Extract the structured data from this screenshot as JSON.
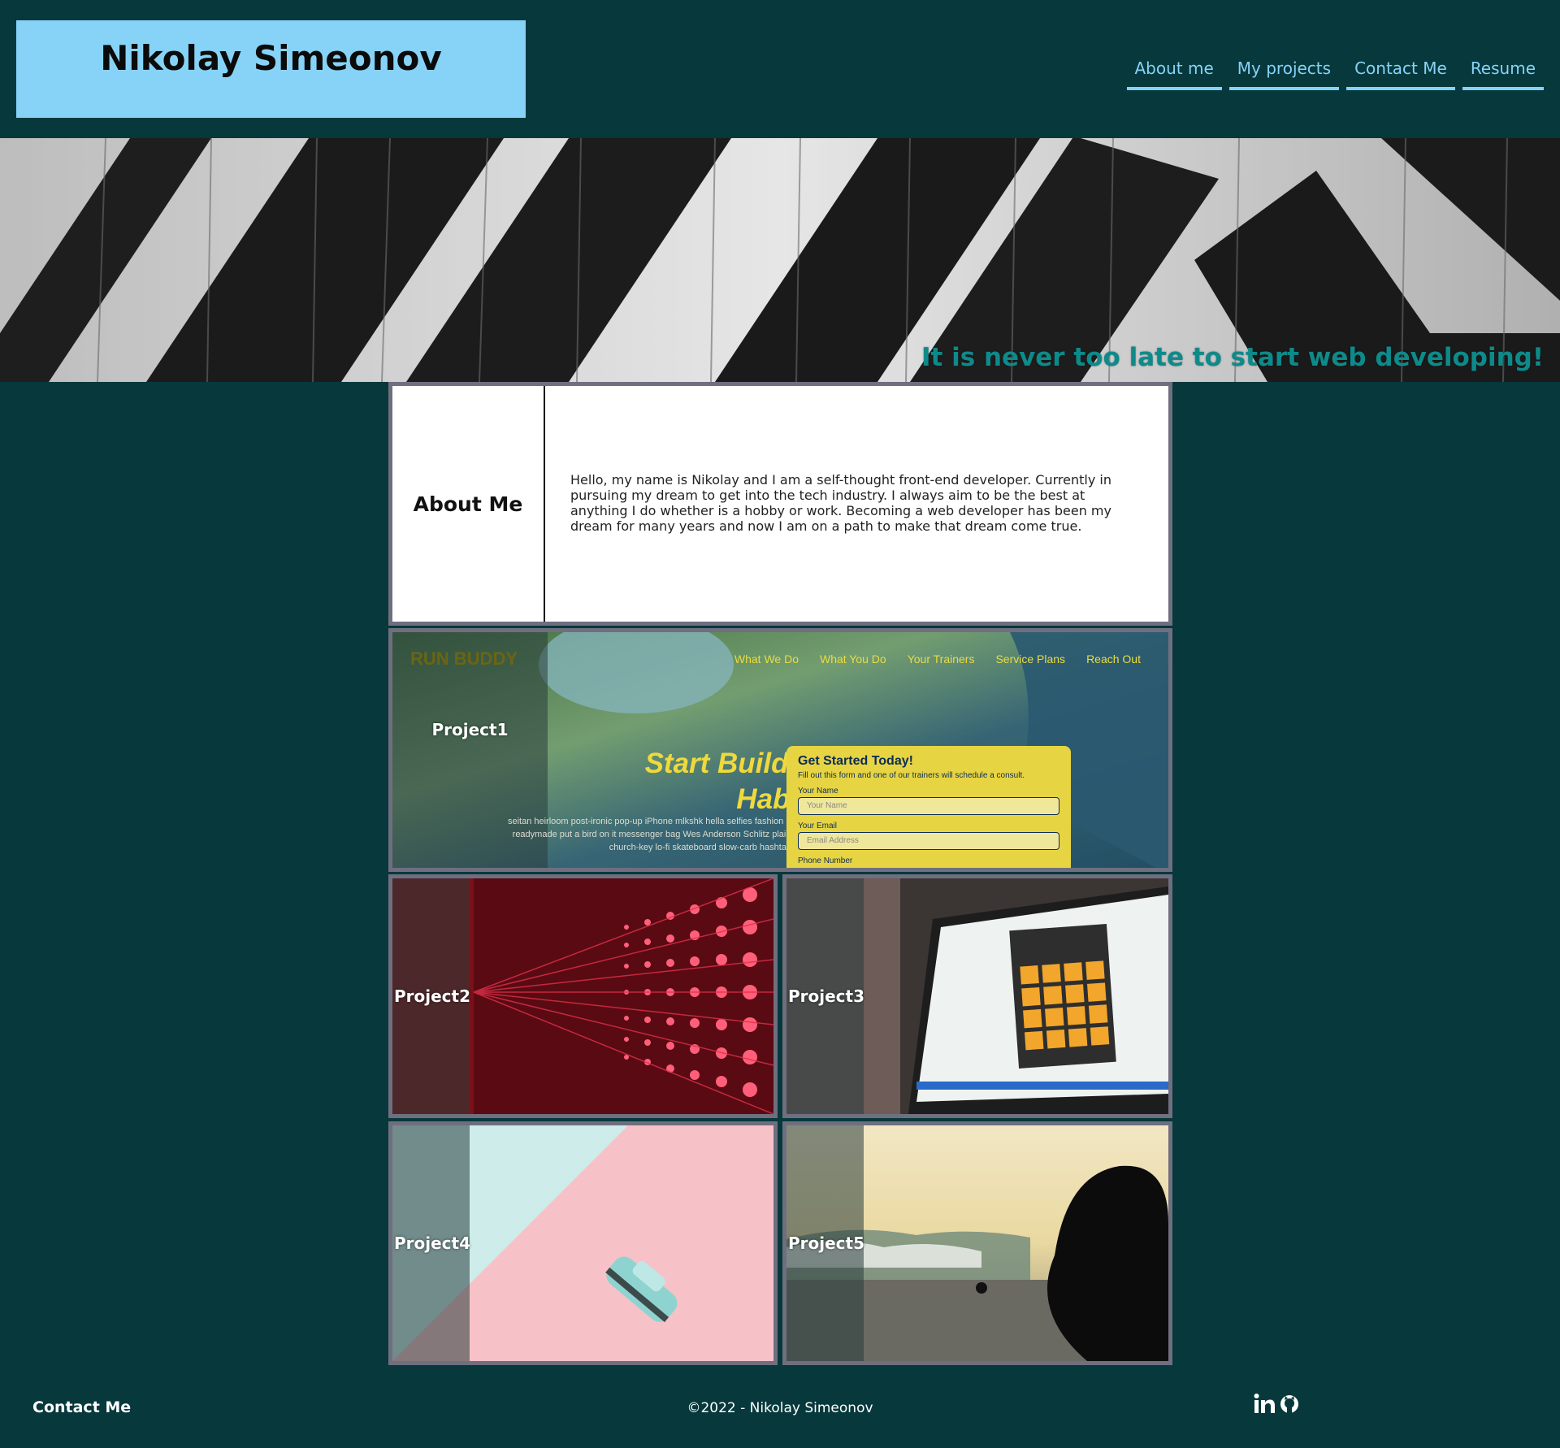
{
  "header": {
    "name": "Nikolay Simeonov",
    "nav": [
      "About me",
      "My projects",
      "Contact Me",
      "Resume"
    ]
  },
  "hero": {
    "tagline": "It is never too late to start web developing!"
  },
  "about": {
    "title": "About Me",
    "text": "Hello, my name is Nikolay and I am a self-thought front-end developer. Currently in pursuing my dream to get into the tech industry. I always aim to be the best at anything I do whether is a hobby or work. Becoming a web developer has been my dream for many years and now I am on a path to make that dream come true."
  },
  "projects": [
    {
      "label": "Project1",
      "preview": {
        "brand": "RUN BUDDY",
        "nav": [
          "What We Do",
          "What You Do",
          "Your Trainers",
          "Service Plans",
          "Reach Out"
        ],
        "headline_1": "Start Building",
        "headline_2": "Habits.",
        "body": "seitan heirloom post-ironic pop-up iPhone mlkshk hella selfies fashion axe occupy readymade put a bird on it messenger bag Wes Anderson Schlitz plaid Bushwick church-key lo-fi skateboard slow-carb hashtag trust fund",
        "form_title": "Get Started Today!",
        "form_sub": "Fill out this form and one of our trainers will schedule a consult.",
        "field_name_label": "Your Name",
        "field_name_placeholder": "Your Name",
        "field_email_label": "Your Email",
        "field_email_placeholder": "Email Address",
        "field_phone_label": "Phone Number"
      }
    },
    {
      "label": "Project2"
    },
    {
      "label": "Project3"
    },
    {
      "label": "Project4"
    },
    {
      "label": "Project5"
    }
  ],
  "footer": {
    "contact": "Contact Me",
    "copyright": "©2022 - Nikolay Simeonov",
    "icons": [
      "linkedin-icon",
      "github-icon"
    ]
  },
  "colors": {
    "background": "#06383c",
    "name_box": "#87d3f7",
    "nav": "#87d3f7",
    "tagline": "#0e8a8a",
    "tile_border": "#6f6f80"
  }
}
